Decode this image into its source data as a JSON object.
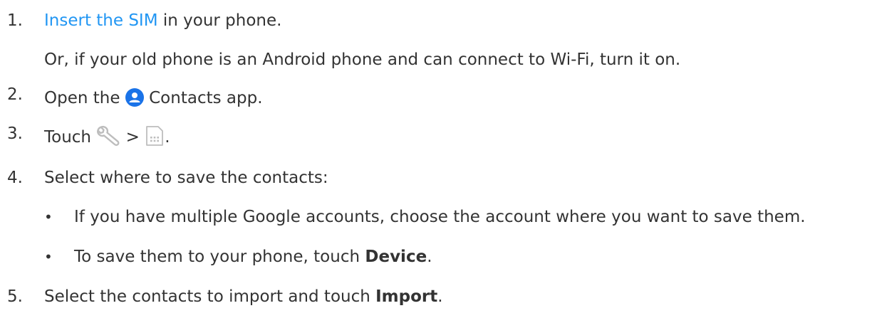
{
  "steps": [
    {
      "num": "1.",
      "link_text": "Insert the SIM",
      "after_link": " in your phone.",
      "sub": "Or, if your old phone is an Android phone and can connect to Wi-Fi, turn it on."
    },
    {
      "num": "2.",
      "before_icon": "Open the ",
      "icon": "contacts-app-icon",
      "after_icon": " Contacts app."
    },
    {
      "num": "3.",
      "before_icon": "Touch ",
      "icon1": "wrench-icon",
      "separator": " > ",
      "icon2": "sim-card-icon",
      "after_icons": "."
    },
    {
      "num": "4.",
      "text": "Select where to save the contacts:",
      "bullets": [
        {
          "text": "If you have multiple Google accounts, choose the account where you want to save them."
        },
        {
          "before_bold": "To save them to your phone, touch ",
          "bold": "Device",
          "after_bold": "."
        }
      ]
    },
    {
      "num": "5.",
      "before_bold": "Select the contacts to import and touch ",
      "bold": "Import",
      "after_bold": "."
    }
  ],
  "colors": {
    "text": "#333333",
    "link": "#2196f3",
    "contacts_icon": "#1a73e8",
    "muted_icon": "#bdbdbd"
  }
}
